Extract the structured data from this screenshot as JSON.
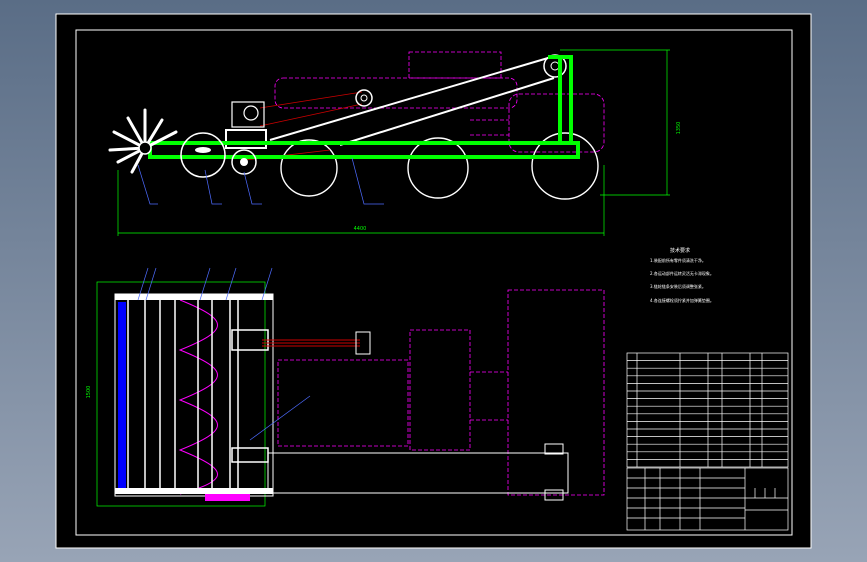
{
  "viewport": {
    "background_top": "#5a6d86",
    "background_bottom": "#98a4b6",
    "sheet_color": "#000000"
  },
  "colors": {
    "frame": "#ffffff",
    "outline": "#ffffff",
    "chassis": "#00ff00",
    "hidden": "#ff00ff",
    "dimension": "#00ff00",
    "leader": "#4d6bff",
    "blade": "#0000ff",
    "belt": "#cc0000",
    "accent": "#ff00ff"
  },
  "drawing": {
    "side_view": {
      "overall_dimension": "4400",
      "height_dimension": "1350"
    },
    "top_view": {
      "width_dimension": "1500"
    },
    "technical_requirements": {
      "title": "技术要求",
      "notes": [
        "1.装配前所有零件须清洗干净。",
        "2.各运动部件运转灵活无卡滞现象。",
        "3.链轮链条安装后须调整张紧。",
        "4.各连接螺栓须拧紧并加弹簧垫圈。"
      ]
    },
    "bom_rows": 15
  }
}
